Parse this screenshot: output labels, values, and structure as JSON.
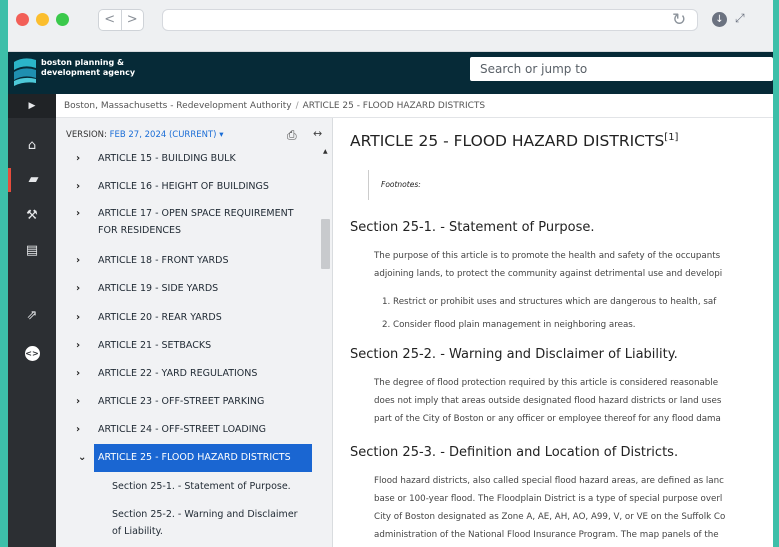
{
  "browser": {
    "back": "<",
    "forward": ">",
    "reload_icon": "reload-icon",
    "download_icon": "download-icon",
    "expand_icon": "expand-icon"
  },
  "header": {
    "logo_line1": "boston planning &",
    "logo_line2": "development agency",
    "search_placeholder": "Search or jump to",
    "brand_colors": {
      "dark": "#062a37",
      "teal": "#2bb5c9"
    }
  },
  "rail": {
    "icons": [
      "expand-caret-icon",
      "home-icon",
      "book-icon",
      "gavel-icon",
      "document-icon",
      "external-link-icon",
      "code-badge-icon"
    ],
    "active": "book-icon"
  },
  "breadcrumb": {
    "root": "Boston, Massachusetts - Redevelopment Authority",
    "separator": "/",
    "current": "ARTICLE 25 - FLOOD HAZARD DISTRICTS"
  },
  "toc": {
    "version_label": "VERSION:",
    "version_value": "FEB 27, 2024 (CURRENT)",
    "version_caret": "▾",
    "items": [
      "ARTICLE 15 - BUILDING BULK",
      "ARTICLE 16 - HEIGHT OF BUILDINGS",
      "ARTICLE 17 - OPEN SPACE REQUIREMENT",
      "FOR RESIDENCES",
      "ARTICLE 18 - FRONT YARDS",
      "ARTICLE 19 - SIDE YARDS",
      "ARTICLE 20 - REAR YARDS",
      "ARTICLE 21 - SETBACKS",
      "ARTICLE 22 - YARD REGULATIONS",
      "ARTICLE 23 - OFF-STREET PARKING",
      "ARTICLE 24 - OFF-STREET LOADING"
    ],
    "selected": "ARTICLE 25 - FLOOD HAZARD DISTRICTS",
    "subitems": [
      "Section 25-1. - Statement of Purpose.",
      "Section 25-2. - Warning and Disclaimer",
      "of Liability."
    ],
    "selected_color": "#1a66d2"
  },
  "content": {
    "title": "ARTICLE 25 - FLOOD HAZARD DISTRICTS",
    "title_footnote": "[1]",
    "footnotes_label": "Footnotes:",
    "s1_heading": "Section 25-1. - Statement of Purpose.",
    "s1_p1": "The purpose of this article is to promote the health and safety of the occupants",
    "s1_p2": "adjoining lands, to protect the community against detrimental use and developi",
    "s1_li1": "1.  Restrict or prohibit uses and structures which are dangerous to health, saf",
    "s1_li2": "2.  Consider flood plain management in neighboring areas.",
    "s2_heading": "Section 25-2. - Warning and Disclaimer of Liability.",
    "s2_p1": "The degree of flood protection required by this article is considered reasonable",
    "s2_p2": "does not imply that areas outside designated flood hazard districts or land uses",
    "s2_p3": "part of the City of Boston or any officer or employee thereof for any flood dama",
    "s3_heading": "Section 25-3. - Definition and Location of Districts.",
    "s3_p1": "Flood hazard districts, also called special flood hazard areas, are defined as lanc",
    "s3_p2": "base or 100-year flood. The Floodplain District is a type of special purpose overl",
    "s3_p3": "City of Boston designated as Zone A, AE, AH, AO, A99, V, or VE on the Suffolk Co",
    "s3_p4": "administration of the National Flood Insurance Program. The map panels of the"
  }
}
